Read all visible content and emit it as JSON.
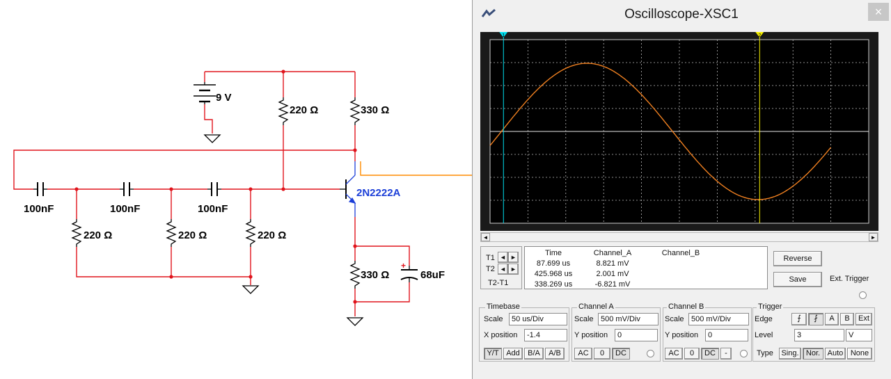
{
  "schematic": {
    "battery_label": "9 V",
    "r_top_left": "220 Ω",
    "r_top_right": "330 Ω",
    "transistor_label": "2N2222A",
    "cap1_label": "100nF",
    "cap2_label": "100nF",
    "cap3_label": "100nF",
    "r_bottom1": "220 Ω",
    "r_bottom2": "220 Ω",
    "r_bottom3": "220 Ω",
    "r_emitter": "330 Ω",
    "c_emitter": "68uF",
    "c_polarity": "+",
    "colors": {
      "wire": "#e0141c",
      "probe_wire": "#ff8c00",
      "component": "#000000",
      "transistor_label": "#1c3fd8"
    }
  },
  "oscilloscope": {
    "title": "Oscilloscope-XSC1",
    "close_icon": "×",
    "screen": {
      "background": "#000000",
      "trace_color": "#f08020",
      "cursor1_color": "#00e0f0",
      "cursor2_color": "#f5f000",
      "cursor1_marker": "1",
      "cursor2_marker": "2",
      "cursor1_time_us": 87.699,
      "cursor2_time_us": 425.968,
      "x_offset_div": -1.4,
      "timebase_us_per_div": 50,
      "volts_mv_per_div": 500,
      "amplitude_mv": 9.0,
      "period_us": 452,
      "zero_crossing_us": 85
    },
    "scroll_left": "◄",
    "scroll_right": "►",
    "cursor_labels": {
      "t1": "T1",
      "t2": "T2",
      "t2t1": "T2-T1",
      "arrow_left": "◄",
      "arrow_right": "►"
    },
    "measurements": {
      "headers": [
        "Time",
        "Channel_A",
        "Channel_B"
      ],
      "rows": [
        [
          "87.699 us",
          "8.821 mV",
          ""
        ],
        [
          "425.968 us",
          "2.001 mV",
          ""
        ],
        [
          "338.269 us",
          "-6.821 mV",
          ""
        ]
      ]
    },
    "buttons": {
      "reverse": "Reverse",
      "save": "Save",
      "ext_trigger": "Ext. Trigger"
    },
    "timebase": {
      "title": "Timebase",
      "scale_label": "Scale",
      "scale_value": "50 us/Div",
      "xpos_label": "X position",
      "xpos_value": "-1.4",
      "modes": [
        "Y/T",
        "Add",
        "B/A",
        "A/B"
      ]
    },
    "channel_a": {
      "title": "Channel A",
      "scale_label": "Scale",
      "scale_value": "500 mV/Div",
      "ypos_label": "Y position",
      "ypos_value": "0",
      "coupling": [
        "AC",
        "0",
        "DC"
      ]
    },
    "channel_b": {
      "title": "Channel B",
      "scale_label": "Scale",
      "scale_value": "500 mV/Div",
      "ypos_label": "Y position",
      "ypos_value": "0",
      "coupling": [
        "AC",
        "0",
        "DC",
        "-"
      ]
    },
    "trigger": {
      "title": "Trigger",
      "edge_label": "Edge",
      "edge_rise": "⨍",
      "edge_fall": "⨏",
      "edge_a": "A",
      "edge_b": "B",
      "edge_ext": "Ext",
      "level_label": "Level",
      "level_value": "3",
      "level_unit": "V",
      "type_label": "Type",
      "types": [
        "Sing.",
        "Nor.",
        "Auto",
        "None"
      ]
    }
  }
}
